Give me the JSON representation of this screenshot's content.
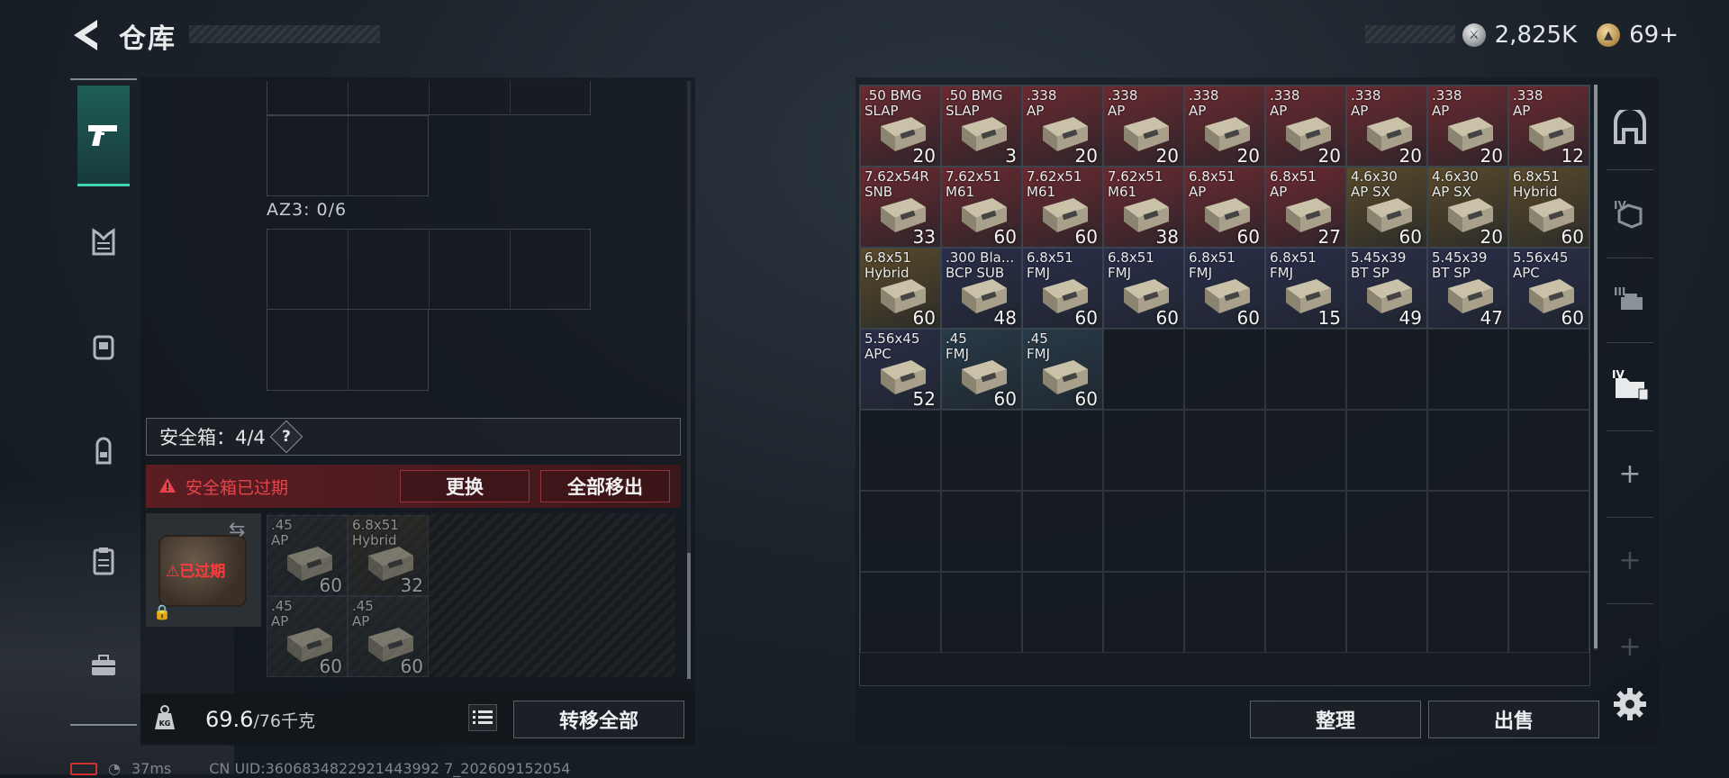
{
  "header": {
    "title": "仓库",
    "silver": "2,825K",
    "gold": "69+"
  },
  "left": {
    "az3_label": "AZ3: 0/6",
    "safebox_label": "安全箱：4/4",
    "help": "?",
    "expired_msg": "安全箱已过期",
    "replace_btn": "更换",
    "remove_all_btn": "全部移出",
    "case_status": "已过期",
    "weight_current": "69.6",
    "weight_max": "/76千克",
    "transfer_all_btn": "转移全部",
    "safe_items": [
      {
        "name": ".45\nAP",
        "count": "60"
      },
      {
        "name": "6.8x51\nHybrid",
        "count": "32"
      },
      {
        "name": ".45\nAP",
        "count": "60"
      },
      {
        "name": ".45\nAP",
        "count": "60"
      }
    ]
  },
  "warehouse": {
    "items": [
      {
        "name": ".50 BMG\nSLAP",
        "count": "20",
        "color": "#6a2a30"
      },
      {
        "name": ".50 BMG\nSLAP",
        "count": "3",
        "color": "#6a2a30"
      },
      {
        "name": ".338\nAP",
        "count": "20",
        "color": "#6a2a30"
      },
      {
        "name": ".338\nAP",
        "count": "20",
        "color": "#6a2a30"
      },
      {
        "name": ".338\nAP",
        "count": "20",
        "color": "#6a2a30"
      },
      {
        "name": ".338\nAP",
        "count": "20",
        "color": "#6a2a30"
      },
      {
        "name": ".338\nAP",
        "count": "20",
        "color": "#6a2a30"
      },
      {
        "name": ".338\nAP",
        "count": "20",
        "color": "#6a2a30"
      },
      {
        "name": ".338\nAP",
        "count": "12",
        "color": "#6a2a30"
      },
      {
        "name": "7.62x54R\nSNB",
        "count": "33",
        "color": "#6a2a30"
      },
      {
        "name": "7.62x51\nM61",
        "count": "60",
        "color": "#6a2a30"
      },
      {
        "name": "7.62x51\nM61",
        "count": "60",
        "color": "#6a2a30"
      },
      {
        "name": "7.62x51\nM61",
        "count": "38",
        "color": "#6a2a30"
      },
      {
        "name": "6.8x51\nAP",
        "count": "60",
        "color": "#6a2a30"
      },
      {
        "name": "6.8x51\nAP",
        "count": "27",
        "color": "#6a2a30"
      },
      {
        "name": "4.6x30\nAP SX",
        "count": "60",
        "color": "#5a4a2a"
      },
      {
        "name": "4.6x30\nAP SX",
        "count": "20",
        "color": "#5a4a2a"
      },
      {
        "name": "6.8x51\nHybrid",
        "count": "60",
        "color": "#5a4a2a"
      },
      {
        "name": "6.8x51\nHybrid",
        "count": "60",
        "color": "#5a4a2a"
      },
      {
        "name": ".300 Bla...\nBCP SUB",
        "count": "48",
        "color": "#2a2e4a"
      },
      {
        "name": "6.8x51\nFMJ",
        "count": "60",
        "color": "#2a2e4a"
      },
      {
        "name": "6.8x51\nFMJ",
        "count": "60",
        "color": "#2a2e4a"
      },
      {
        "name": "6.8x51\nFMJ",
        "count": "60",
        "color": "#2a2e4a"
      },
      {
        "name": "6.8x51\nFMJ",
        "count": "15",
        "color": "#2a2e4a"
      },
      {
        "name": "5.45x39\nBT SP",
        "count": "49",
        "color": "#2a2e4a"
      },
      {
        "name": "5.45x39\nBT SP",
        "count": "47",
        "color": "#2a2e4a"
      },
      {
        "name": "5.56x45\nAPC",
        "count": "60",
        "color": "#2a2e4a"
      },
      {
        "name": "5.56x45\nAPC",
        "count": "52",
        "color": "#2a2e4a"
      },
      {
        "name": ".45\nFMJ",
        "count": "60",
        "color": "#283a48"
      },
      {
        "name": ".45\nFMJ",
        "count": "60",
        "color": "#283a48"
      }
    ],
    "sort_btn": "整理",
    "sell_btn": "出售"
  },
  "footer": {
    "ping": "37ms",
    "uid": "CN UID:3606834822921443992 7_202609152054"
  }
}
